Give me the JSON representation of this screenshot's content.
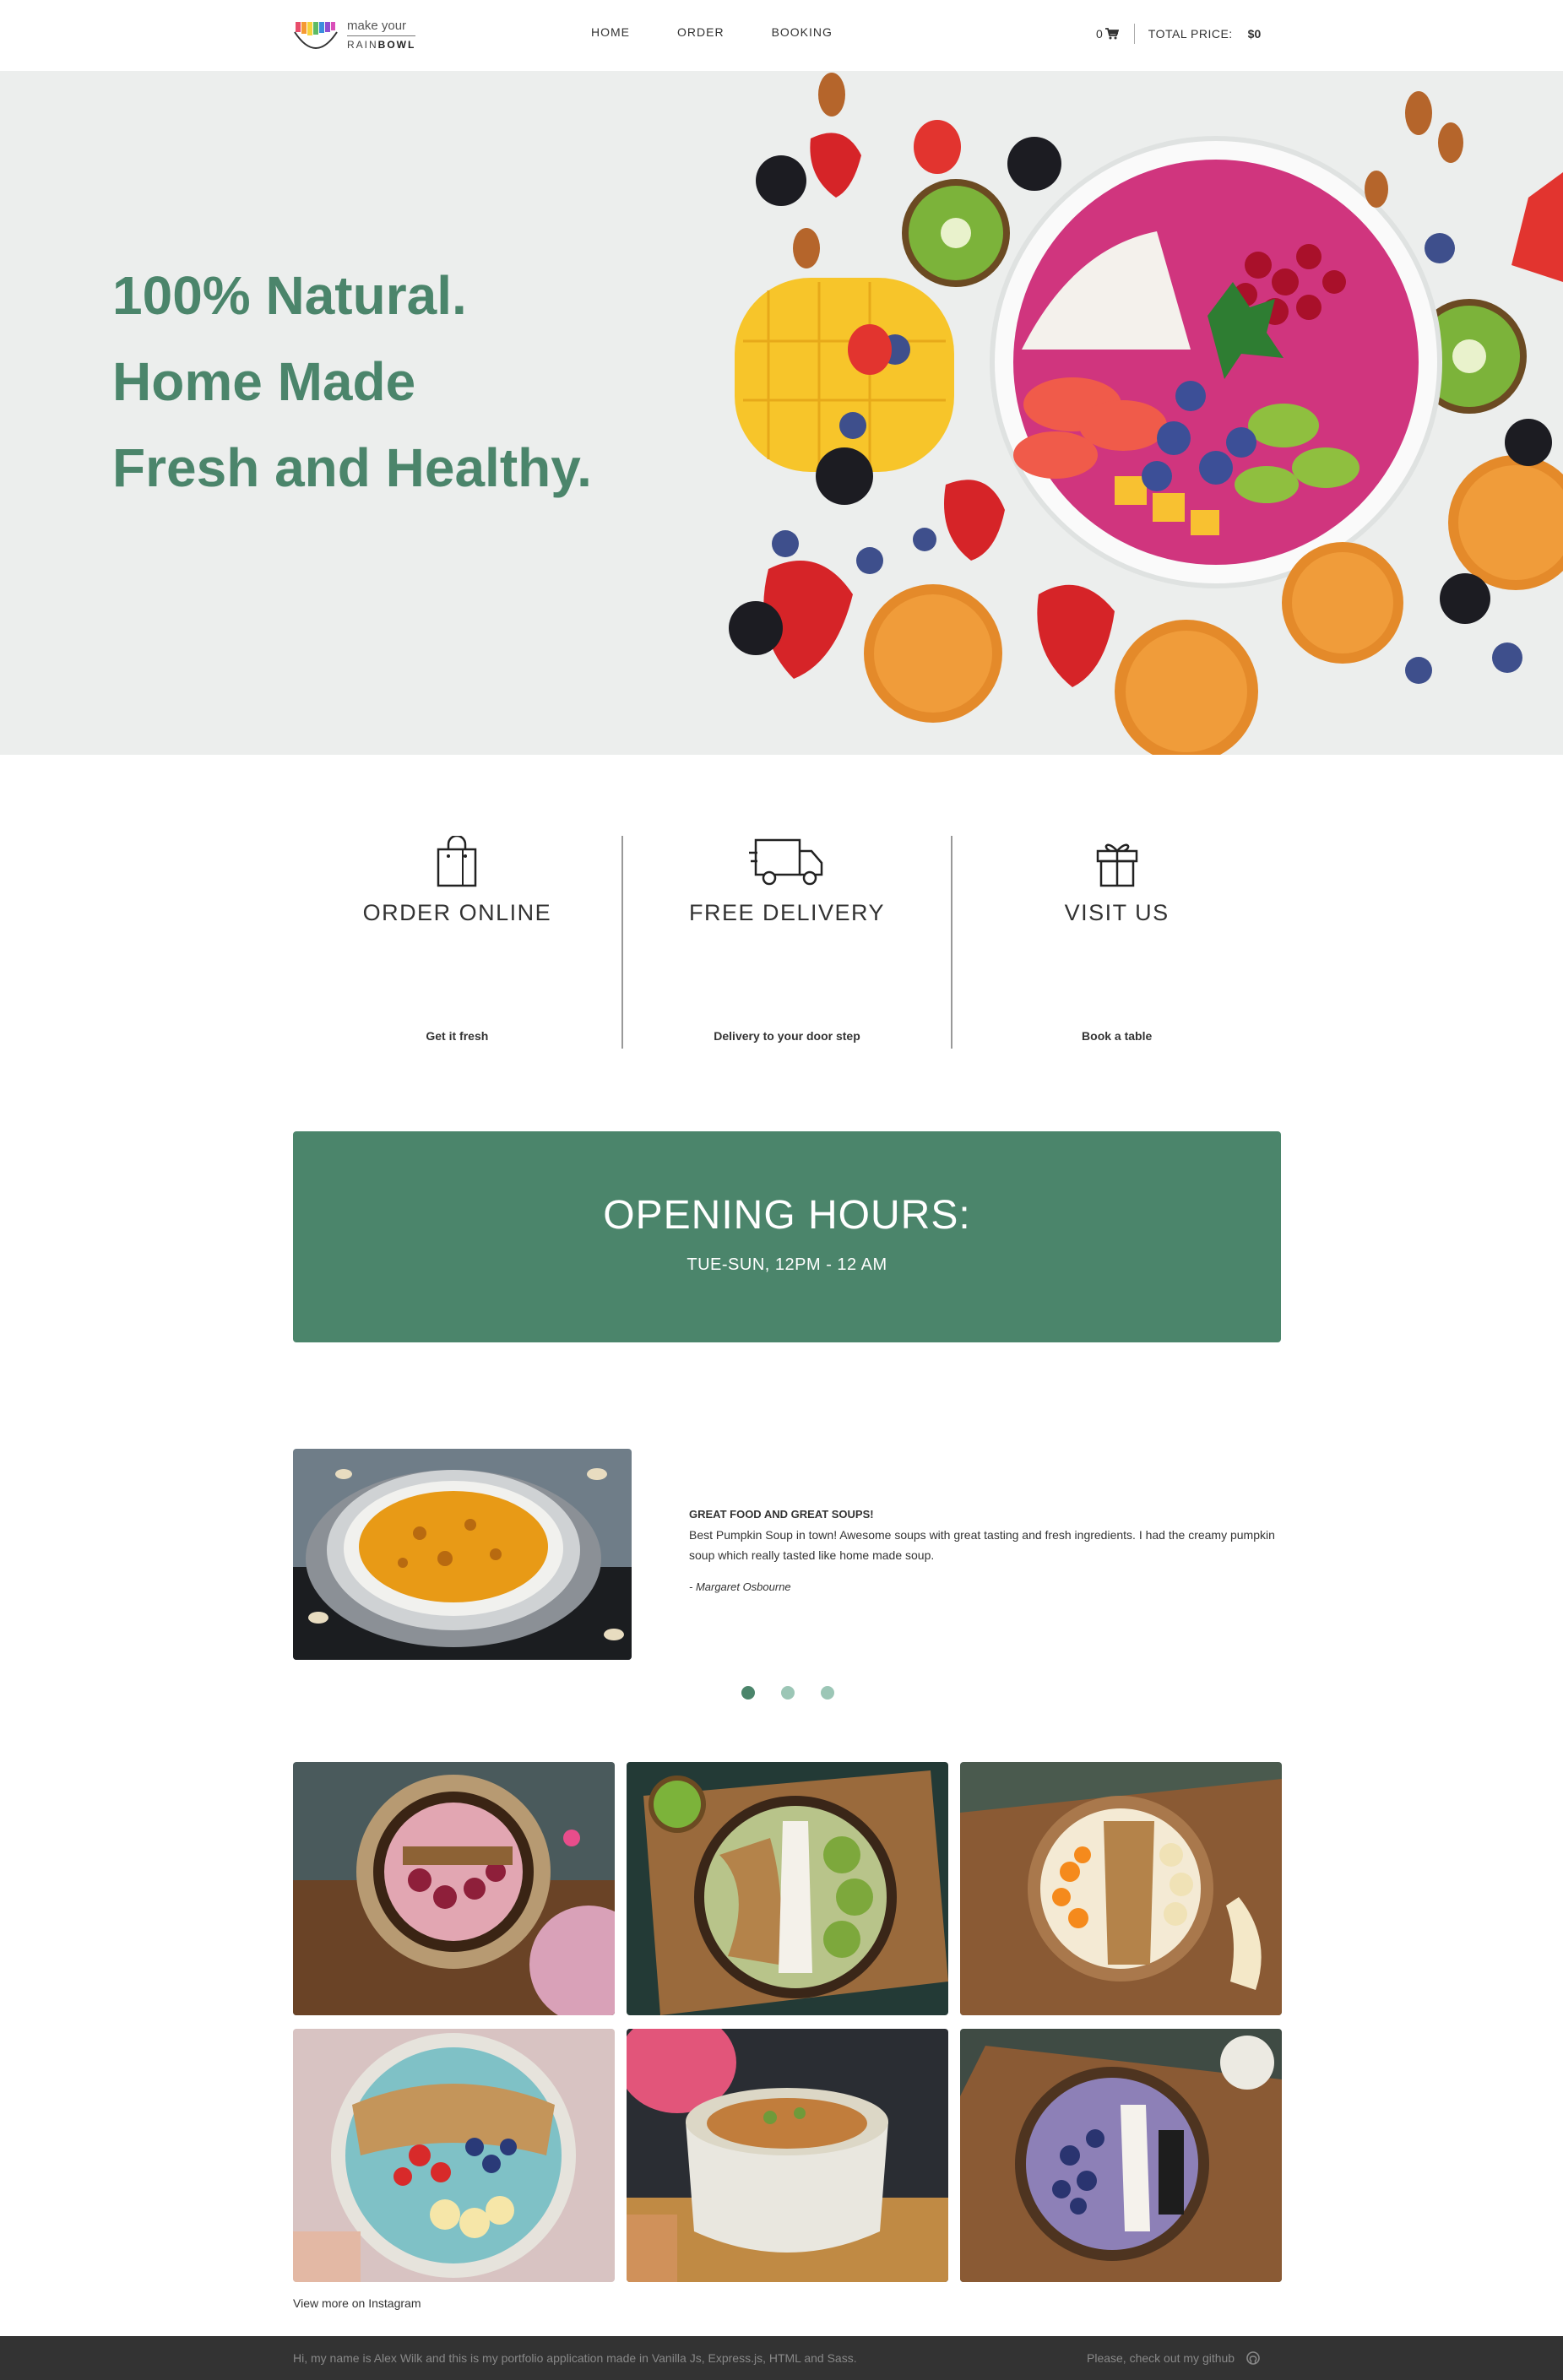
{
  "brand": {
    "make_your": "make your",
    "rain": "RAIN",
    "bowl": "BOWL"
  },
  "nav": [
    {
      "label": "HOME"
    },
    {
      "label": "ORDER"
    },
    {
      "label": "BOOKING"
    }
  ],
  "cart": {
    "count": "0",
    "total_label": "TOTAL PRICE:",
    "total_value": "$0"
  },
  "hero": {
    "lines": [
      "100% Natural.",
      "Home Made",
      "Fresh and Healthy."
    ]
  },
  "features": [
    {
      "title": "ORDER ONLINE",
      "subtitle": "Get it fresh",
      "icon": "shopping-bag-icon"
    },
    {
      "title": "FREE DELIVERY",
      "subtitle": "Delivery to your door step",
      "icon": "delivery-truck-icon"
    },
    {
      "title": "VISIT US",
      "subtitle": "Book a table",
      "icon": "gift-icon"
    }
  ],
  "hours": {
    "title": "OPENING HOURS:",
    "time": "TUE-SUN, 12PM - 12 AM"
  },
  "testimonial": {
    "title": "GREAT FOOD AND GREAT SOUPS!",
    "body": "Best Pumpkin Soup in town! Awesome soups with great tasting and fresh ingredients. I had the creamy pumpkin soup which really tasted like home made soup.",
    "author": "- Margaret Osbourne",
    "slides": 3,
    "active_slide": 1
  },
  "instagram": {
    "link_label": "View more on Instagram"
  },
  "footer": {
    "left": "Hi, my name is Alex Wilk and this is my portfolio application made in Vanilla Js, Express.js, HTML and Sass.",
    "right": "Please, check out my github",
    "icon": "github-icon"
  },
  "colors": {
    "accent": "#4b856b",
    "hero_bg": "#eceeed",
    "footer_bg": "#333333",
    "dot_inactive": "#9cc6b6"
  }
}
